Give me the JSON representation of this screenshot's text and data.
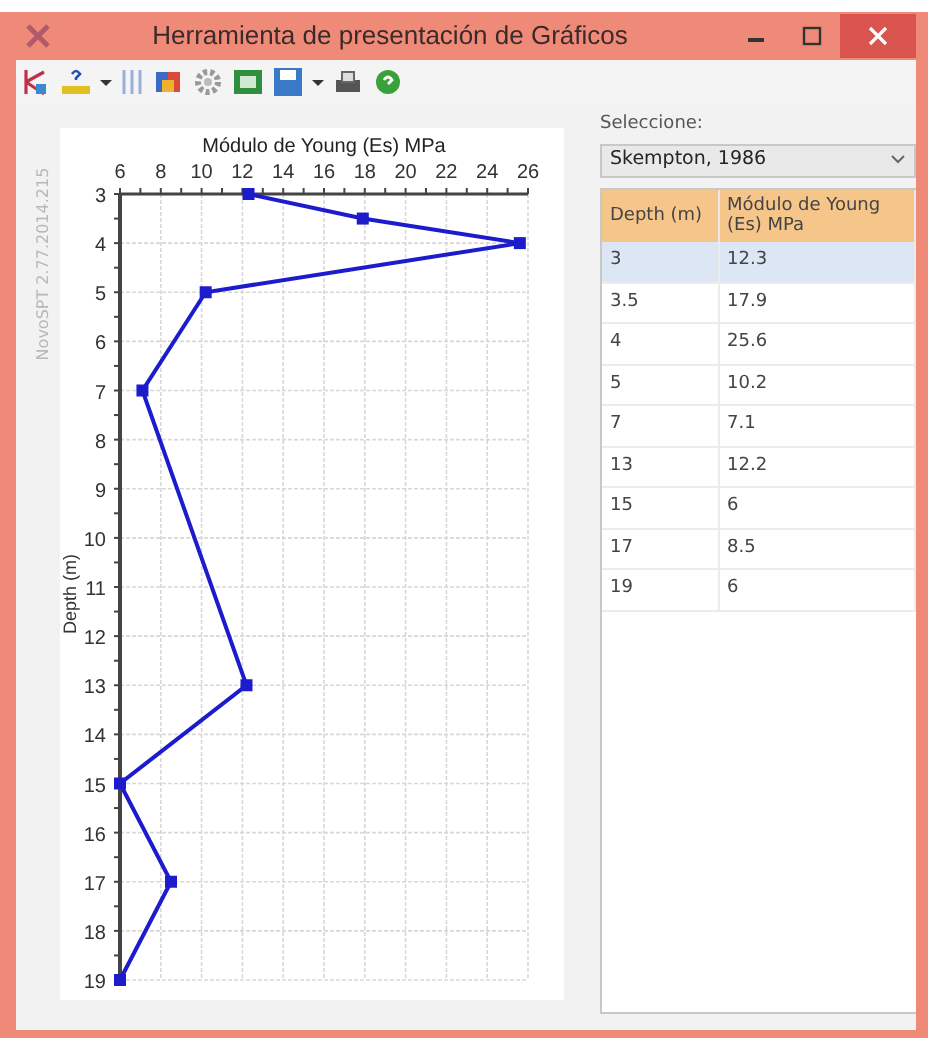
{
  "window": {
    "title": "Herramienta de presentación de Gráficos"
  },
  "chart": {
    "version_label": "NovoSPT 2.77.2014.215",
    "chart_data": {
      "type": "line",
      "xlabel": "Módulo de Young (Es) MPa",
      "ylabel": "Depth (m)",
      "x": [
        12.3,
        17.9,
        25.6,
        10.2,
        7.1,
        12.2,
        6,
        8.5,
        6
      ],
      "grid": true,
      "series": [
        {
          "color": "#1c1ccc",
          "marker": "square",
          "values": [
            3,
            3.5,
            4,
            5,
            7,
            13,
            15,
            17,
            19
          ]
        }
      ],
      "xlim": [
        6,
        26
      ],
      "ylim": [
        19,
        3
      ],
      "xticks": [
        6,
        8,
        10,
        12,
        14,
        16,
        18,
        20,
        22,
        24,
        26
      ],
      "yticks": [
        3,
        4,
        5,
        6,
        7,
        8,
        9,
        10,
        11,
        12,
        13,
        14,
        15,
        16,
        17,
        18,
        19
      ]
    }
  },
  "panel": {
    "select_label": "Seleccione:",
    "select_value": "Skempton, 1986",
    "table": {
      "columns": [
        "Depth (m)",
        "Módulo de Young (Es) MPa"
      ],
      "rows": [
        {
          "cells": [
            "3",
            "12.3"
          ],
          "selected": true
        },
        {
          "cells": [
            "3.5",
            "17.9"
          ],
          "selected": false
        },
        {
          "cells": [
            "4",
            "25.6"
          ],
          "selected": false
        },
        {
          "cells": [
            "5",
            "10.2"
          ],
          "selected": false
        },
        {
          "cells": [
            "7",
            "7.1"
          ],
          "selected": false
        },
        {
          "cells": [
            "13",
            "12.2"
          ],
          "selected": false
        },
        {
          "cells": [
            "15",
            "6"
          ],
          "selected": false
        },
        {
          "cells": [
            "17",
            "8.5"
          ],
          "selected": false
        },
        {
          "cells": [
            "19",
            "6"
          ],
          "selected": false
        }
      ]
    }
  }
}
